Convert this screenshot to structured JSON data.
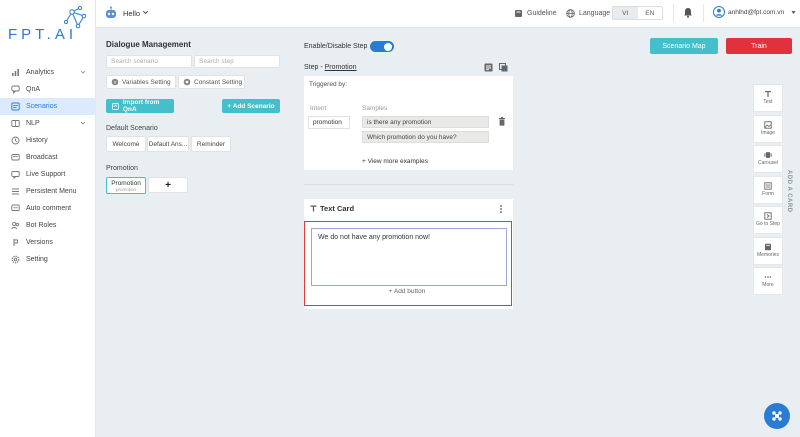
{
  "brand": {
    "logo_text": "FPT.AI",
    "colors": {
      "primary": "#2a7bd4",
      "teal": "#43c0cb",
      "danger": "#e0323e"
    }
  },
  "sidebar": {
    "items": [
      {
        "label": "Analytics",
        "icon": "chart-icon",
        "has_chevron": true
      },
      {
        "label": "QnA",
        "icon": "chat-icon"
      },
      {
        "label": "Scenarios",
        "icon": "scenario-icon",
        "active": true
      },
      {
        "label": "NLP",
        "icon": "nlp-icon",
        "has_chevron": true
      },
      {
        "label": "History",
        "icon": "history-icon"
      },
      {
        "label": "Broadcast",
        "icon": "broadcast-icon"
      },
      {
        "label": "Live Support",
        "icon": "support-icon"
      },
      {
        "label": "Persistent Menu",
        "icon": "menu-icon"
      },
      {
        "label": "Auto comment",
        "icon": "comment-icon"
      },
      {
        "label": "Bot Roles",
        "icon": "roles-icon"
      },
      {
        "label": "Versions",
        "icon": "versions-icon"
      },
      {
        "label": "Setting",
        "icon": "gear-icon"
      }
    ]
  },
  "topbar": {
    "bot_name": "Hello",
    "guideline": "Guideline",
    "language": "Language",
    "lang_vi": "VI",
    "lang_en": "EN",
    "user_email": "anhlhd@fpt.com.vn"
  },
  "dialogue": {
    "title": "Dialogue Management",
    "search_scenario_placeholder": "Search scenario",
    "search_step_placeholder": "Search step",
    "variables_setting": "Variables Setting",
    "constant_setting": "Constant Setting",
    "import_qna": "Import from QnA",
    "add_scenario": "+ Add Scenario",
    "default_scenario_label": "Default Scenario",
    "default_steps": [
      "Welcome",
      "Default Ans...",
      "Reminder"
    ],
    "promotion_label": "Promotion",
    "promotion_step_title": "Promotion",
    "promotion_step_sub": "promotion",
    "add_step_symbol": "+"
  },
  "editor": {
    "toggle_label": "Enable/Disable Step",
    "step_prefix": "Step - ",
    "step_name": "Promotion",
    "triggered_by": "Triggered by:",
    "intent_header": "Intent",
    "samples_header": "Samples",
    "intent_value": "promotion",
    "samples": [
      "is there any promotion",
      "Which promotion do you have?"
    ],
    "view_more": "+ View more examples",
    "text_card_title": "Text Card",
    "text_card_value": "We do not have any promotion now!",
    "add_button": "+ Add button"
  },
  "actions": {
    "scenario_map": "Scenario Map",
    "train": "Train"
  },
  "palette": {
    "vertical_label": "ADD A CARD",
    "items": [
      {
        "label": "Text",
        "icon": "text-icon"
      },
      {
        "label": "Image",
        "icon": "image-icon"
      },
      {
        "label": "Carousel",
        "icon": "carousel-icon"
      },
      {
        "label": "Form",
        "icon": "form-icon"
      },
      {
        "label": "Go to Step",
        "icon": "goto-step-icon"
      },
      {
        "label": "Memories",
        "icon": "memories-icon"
      },
      {
        "label": "More",
        "icon": "more-icon"
      }
    ]
  }
}
